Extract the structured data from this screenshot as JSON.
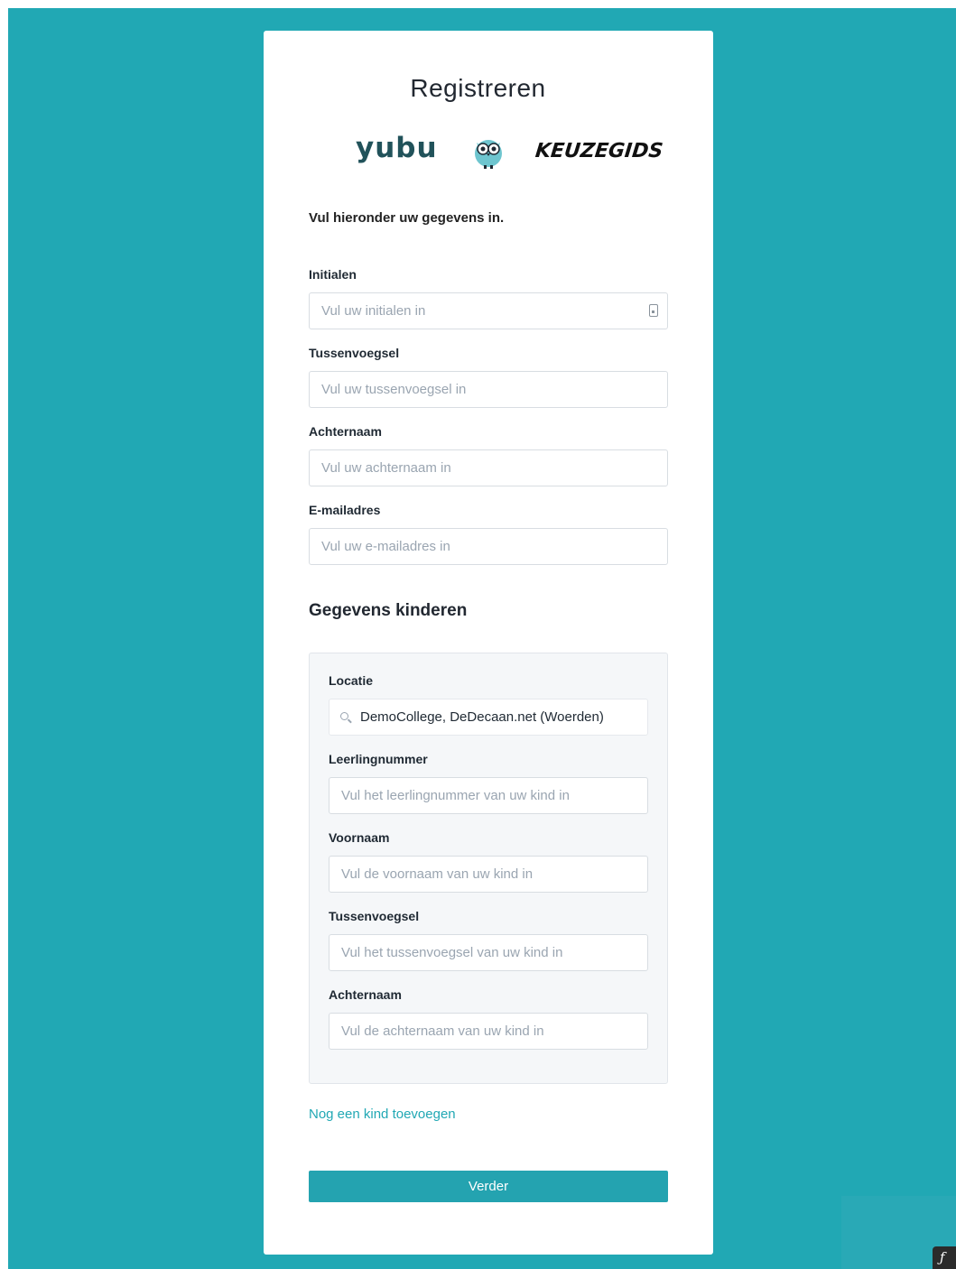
{
  "page": {
    "title": "Registreren",
    "intro": "Vul hieronder uw gegevens in."
  },
  "logos": {
    "yubu": "yubu",
    "keuzegids": "KEUZEGIDS"
  },
  "parent_fields": {
    "initials": {
      "label": "Initialen",
      "placeholder": "Vul uw initialen in"
    },
    "infix": {
      "label": "Tussenvoegsel",
      "placeholder": "Vul uw tussenvoegsel in"
    },
    "lastname": {
      "label": "Achternaam",
      "placeholder": "Vul uw achternaam in"
    },
    "email": {
      "label": "E-mailadres",
      "placeholder": "Vul uw e-mailadres in"
    }
  },
  "children": {
    "section_title": "Gegevens kinderen",
    "location": {
      "label": "Locatie",
      "value": "DemoCollege, DeDecaan.net (Woerden)"
    },
    "student_number": {
      "label": "Leerlingnummer",
      "placeholder": "Vul het leerlingnummer van uw kind in"
    },
    "firstname": {
      "label": "Voornaam",
      "placeholder": "Vul de voornaam van uw kind in"
    },
    "infix": {
      "label": "Tussenvoegsel",
      "placeholder": "Vul het tussenvoegsel van uw kind in"
    },
    "lastname": {
      "label": "Achternaam",
      "placeholder": "Vul de achternaam van uw kind in"
    },
    "add_child": "Nog een kind toevoegen"
  },
  "actions": {
    "submit": "Verder"
  },
  "colors": {
    "background": "#21a8b4",
    "accent": "#24a3b0",
    "card": "#ffffff"
  },
  "icons": {
    "contact_card": "contact-card-icon",
    "search": "search-icon",
    "owl": "owl-logo"
  }
}
